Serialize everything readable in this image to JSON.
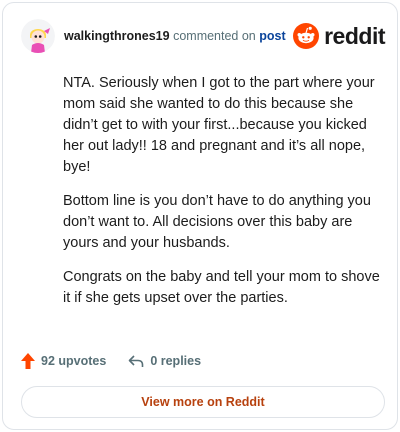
{
  "header": {
    "username": "walkingthrones19",
    "commented_on": "commented on",
    "post_link": "post",
    "brand": "reddit"
  },
  "comment": {
    "paragraphs": [
      "NTA. Seriously when I got to the part where your mom said she wanted to do this because she didn’t get to with your first...because you kicked her out lady!! 18 and pregnant and it’s all nope, bye!",
      "Bottom line is you don’t have to do anything you don’t want to. All decisions over this baby are yours and your husbands.",
      "Congrats on the baby and tell your mom to shove it if she gets upset over the parties."
    ]
  },
  "actions": {
    "upvotes": "92 upvotes",
    "replies": "0 replies"
  },
  "footer": {
    "view_more": "View more on Reddit"
  },
  "colors": {
    "upvote": "#ff4500",
    "brand": "#ff4500",
    "link": "#0a449b",
    "cta": "#b7410e"
  }
}
